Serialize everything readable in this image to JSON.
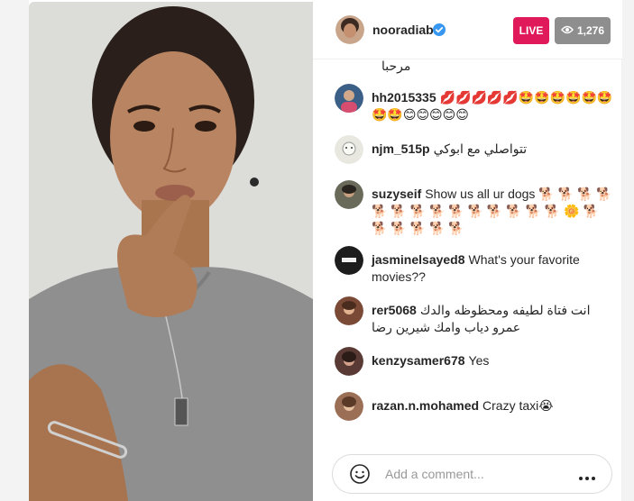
{
  "broadcast": {
    "username": "nooradiab",
    "live_label": "LIVE",
    "viewer_count": "1,276"
  },
  "comments": {
    "truncated_top_line": "مرحبا",
    "items": [
      {
        "user": "hh2015335",
        "text": "💋💋💋💋💋🤩🤩🤩🤩🤩🤩🤩🤩😊😊😊😊😊"
      },
      {
        "user": "njm_515p",
        "text": "تتواصلي مع ابوكي"
      },
      {
        "user": "suzyseif",
        "text": "Show us all ur dogs 🐕 🐕 🐕 🐕 🐕 🐕 🐕 🐕 🐕 🐕 🐕 🐕 🐕 🐕 🌼 🐕 🐕 🐕 🐕 🐕 🐕"
      },
      {
        "user": "jasminelsayed8",
        "text": "What's your favorite movies??"
      },
      {
        "user": "rer5068",
        "text": "انت فتاة لطيفه ومحظوظه والدك عمرو دياب وامك شيرين رضا"
      },
      {
        "user": "kenzysamer678",
        "text": "Yes"
      },
      {
        "user": "razan.n.mohamed",
        "text": "Crazy taxi😭"
      }
    ]
  },
  "composer": {
    "placeholder": "Add a comment..."
  },
  "icons": {
    "verified": "verified-badge-icon",
    "viewers": "eye-icon",
    "emoji": "smiley-icon",
    "more": "ellipsis-icon"
  },
  "colors": {
    "live": "#e0195a",
    "viewers_badge": "#8e8e8e",
    "verified": "#3897f0"
  }
}
